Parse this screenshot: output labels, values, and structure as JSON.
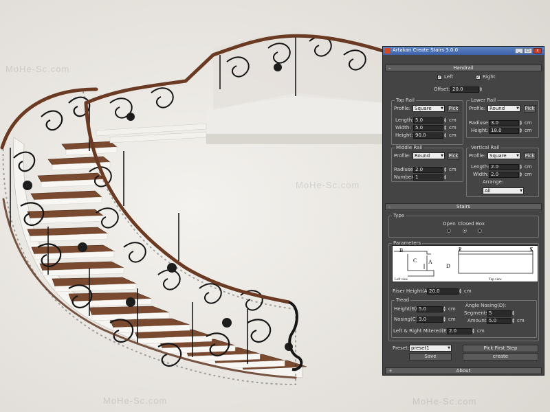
{
  "watermark": "MoHe-Sc.com",
  "panel": {
    "title": "Artakan Create Stairs 3.0.0",
    "window_buttons": {
      "minimize": "_",
      "maximize": "□",
      "close": "x"
    },
    "handrail": {
      "header": "Handrail",
      "collapse_symbol": "–",
      "left_label": "Left",
      "left_checked": true,
      "right_label": "Right",
      "right_checked": true,
      "offset_label": "Offset:",
      "offset_value": "20.0"
    },
    "top_rail": {
      "title": "Top Rail",
      "profile_label": "Profile:",
      "profile_value": "Square",
      "pick_label": "Pick",
      "length_label": "Length:",
      "length_value": "5.0",
      "width_label": "Width:",
      "width_value": "5.0",
      "height_label": "Height:",
      "height_value": "90.0",
      "unit": "cm"
    },
    "lower_rail": {
      "title": "Lower Rail",
      "profile_label": "Profile:",
      "profile_value": "Round",
      "pick_label": "Pick",
      "radius_label": "Radiuse:",
      "radius_value": "3.0",
      "height_label": "Height:",
      "height_value": "18.0",
      "unit": "cm"
    },
    "middle_rail": {
      "title": "Middle Rail",
      "profile_label": "Profile:",
      "profile_value": "Round",
      "pick_label": "Pick",
      "radius_label": "Radiuse:",
      "radius_value": "2.0",
      "number_label": "Number:",
      "number_value": "1",
      "unit": "cm"
    },
    "vertical_rail": {
      "title": "Vertical Rail",
      "profile_label": "Profile:",
      "profile_value": "Square",
      "pick_label": "Pick",
      "length_label": "Length:",
      "length_value": "2.0",
      "width_label": "Width:",
      "width_value": "2.0",
      "arrange_label": "Arrange:",
      "arrange_value": "All",
      "unit": "cm"
    },
    "stairs": {
      "header": "Stairs",
      "collapse_symbol": "–",
      "type_title": "Type",
      "type_options": [
        "Open",
        "Closed",
        "Box"
      ],
      "type_selected": "Closed",
      "parameters_title": "Parameters",
      "diagram_labels": {
        "b": "B",
        "c": "C",
        "a": "A",
        "d": "D",
        "e1": "E",
        "e2": "E",
        "left_view": "Left view",
        "top_view": "Top view"
      },
      "riser_label": "Riser Height(A):",
      "riser_value": "20.0",
      "unit": "cm",
      "tread_title": "Tread",
      "tread_height_label": "Height(B):",
      "tread_height_value": "5.0",
      "nosing_label": "Nosing(C):",
      "nosing_value": "3.0",
      "angle_title": "Angle Nosing(D):",
      "segments_label": "Segments:",
      "segments_value": "5",
      "amount_label": "Amount:",
      "amount_value": "5.0",
      "mitered_label": "Left & Right Mitered(E):",
      "mitered_value": "2.0"
    },
    "footer": {
      "preset_label": "Preset:",
      "preset_value": "preset1",
      "save_label": "Save",
      "pick_first_label": "Pick First Step",
      "create_label": "create"
    },
    "about": {
      "header": "About",
      "expand_symbol": "+"
    }
  },
  "colors": {
    "panel_bg": "#444444",
    "titlebar": "#3d62a8",
    "wood": "#6a3a22",
    "iron": "#151515",
    "marble": "#f3f1ec"
  }
}
